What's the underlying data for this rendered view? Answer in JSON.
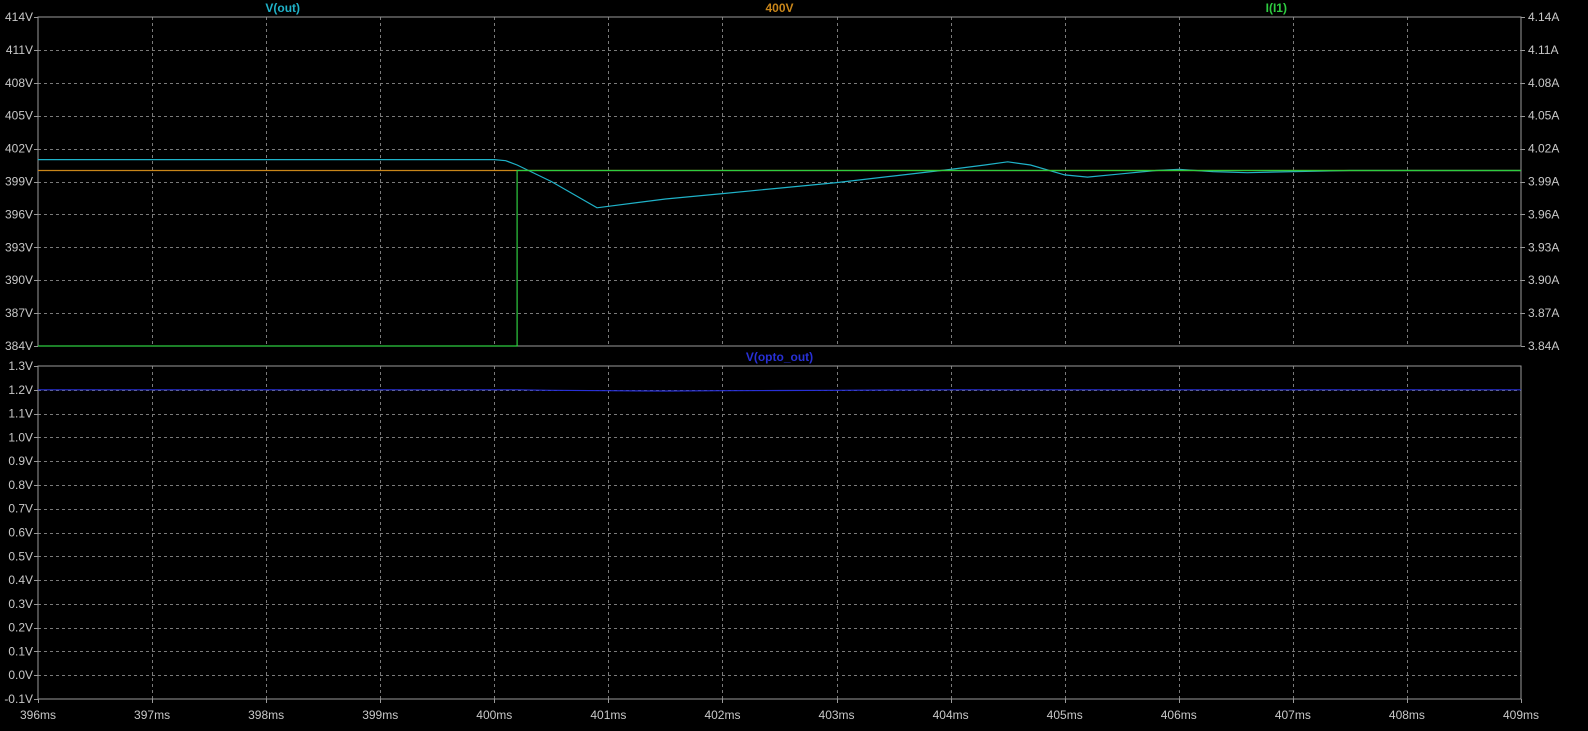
{
  "chart_data": [
    {
      "type": "line",
      "pane": "top",
      "xlim": [
        396,
        409
      ],
      "x_unit": "ms",
      "x_ticks": [
        "396ms",
        "397ms",
        "398ms",
        "399ms",
        "400ms",
        "401ms",
        "402ms",
        "403ms",
        "404ms",
        "405ms",
        "406ms",
        "407ms",
        "408ms",
        "409ms"
      ],
      "ylim_left": [
        384,
        414
      ],
      "y_ticks_left": [
        "414V",
        "411V",
        "408V",
        "405V",
        "402V",
        "399V",
        "396V",
        "393V",
        "390V",
        "387V",
        "384V"
      ],
      "ylim_right": [
        3.84,
        4.14
      ],
      "y_ticks_right": [
        "4.14A",
        "4.11A",
        "4.08A",
        "4.05A",
        "4.02A",
        "3.99A",
        "3.96A",
        "3.93A",
        "3.90A",
        "3.87A",
        "3.84A"
      ],
      "grid": true,
      "series": [
        {
          "name": "V(out)",
          "axis": "left",
          "color": "#1fb2c8",
          "points": [
            [
              396,
              401.0
            ],
            [
              400.0,
              401.0
            ],
            [
              400.1,
              400.9
            ],
            [
              400.2,
              400.5
            ],
            [
              400.5,
              399.0
            ],
            [
              400.9,
              396.6
            ],
            [
              401.5,
              397.4
            ],
            [
              402.0,
              397.9
            ],
            [
              402.5,
              398.4
            ],
            [
              403.0,
              398.9
            ],
            [
              403.5,
              399.5
            ],
            [
              404.0,
              400.1
            ],
            [
              404.3,
              400.5
            ],
            [
              404.5,
              400.8
            ],
            [
              404.7,
              400.5
            ],
            [
              405.0,
              399.6
            ],
            [
              405.2,
              399.4
            ],
            [
              405.5,
              399.7
            ],
            [
              405.8,
              400.0
            ],
            [
              406.0,
              400.1
            ],
            [
              406.3,
              399.9
            ],
            [
              406.6,
              399.8
            ],
            [
              407.0,
              399.9
            ],
            [
              407.5,
              400.0
            ],
            [
              408.0,
              400.0
            ],
            [
              408.5,
              400.0
            ],
            [
              409,
              400.0
            ]
          ]
        },
        {
          "name": "400V",
          "axis": "left",
          "color": "#c9861a",
          "points": [
            [
              396,
              400.0
            ],
            [
              409,
              400.0
            ]
          ]
        },
        {
          "name": "I(I1)",
          "axis": "right",
          "color": "#2ecc40",
          "points": [
            [
              396,
              3.84
            ],
            [
              400.2,
              3.84
            ],
            [
              400.2,
              4.0
            ],
            [
              409,
              4.0
            ]
          ]
        }
      ]
    },
    {
      "type": "line",
      "pane": "bottom",
      "xlim": [
        396,
        409
      ],
      "x_unit": "ms",
      "ylim_left": [
        -0.1,
        1.3
      ],
      "y_ticks_left": [
        "1.3V",
        "1.2V",
        "1.1V",
        "1.0V",
        "0.9V",
        "0.8V",
        "0.7V",
        "0.6V",
        "0.5V",
        "0.4V",
        "0.3V",
        "0.2V",
        "0.1V",
        "0.0V",
        "-0.1V"
      ],
      "grid": true,
      "series": [
        {
          "name": "V(opto_out)",
          "axis": "left",
          "color": "#2830d6",
          "points": [
            [
              396,
              1.2
            ],
            [
              400.2,
              1.2
            ],
            [
              400.5,
              1.198
            ],
            [
              401.0,
              1.196
            ],
            [
              401.5,
              1.195
            ],
            [
              402.0,
              1.196
            ],
            [
              402.5,
              1.197
            ],
            [
              403.0,
              1.198
            ],
            [
              403.5,
              1.199
            ],
            [
              404.0,
              1.2
            ],
            [
              409,
              1.2
            ]
          ]
        }
      ]
    }
  ]
}
